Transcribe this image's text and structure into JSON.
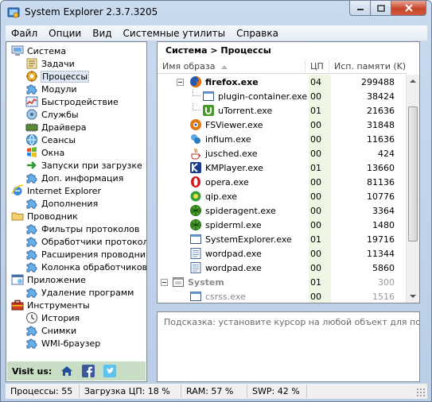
{
  "window": {
    "title": "System Explorer 2.3.7.3205"
  },
  "menu": [
    "Файл",
    "Опции",
    "Вид",
    "Системные утилиты",
    "Справка"
  ],
  "tree": [
    {
      "label": "Система",
      "indent": 0,
      "icon": "computer-icon"
    },
    {
      "label": "Задачи",
      "indent": 1,
      "icon": "tasks-icon"
    },
    {
      "label": "Процессы",
      "indent": 1,
      "icon": "processes-icon",
      "selected": true
    },
    {
      "label": "Модули",
      "indent": 1,
      "icon": "puzzle-icon"
    },
    {
      "label": "Быстродействие",
      "indent": 1,
      "icon": "performance-icon"
    },
    {
      "label": "Службы",
      "indent": 1,
      "icon": "services-icon"
    },
    {
      "label": "Драйвера",
      "indent": 1,
      "icon": "drivers-icon"
    },
    {
      "label": "Сеансы",
      "indent": 1,
      "icon": "sessions-icon"
    },
    {
      "label": "Окна",
      "indent": 1,
      "icon": "windows-icon"
    },
    {
      "label": "Запуски при загрузке",
      "indent": 1,
      "icon": "startup-icon"
    },
    {
      "label": "Доп. информация",
      "indent": 1,
      "icon": "puzzle-icon"
    },
    {
      "label": "Internet Explorer",
      "indent": 0,
      "icon": "ie-icon"
    },
    {
      "label": "Дополнения",
      "indent": 1,
      "icon": "puzzle-icon"
    },
    {
      "label": "Проводник",
      "indent": 0,
      "icon": "folder-icon"
    },
    {
      "label": "Фильтры протоколов",
      "indent": 1,
      "icon": "puzzle-icon"
    },
    {
      "label": "Обработчики протокола",
      "indent": 1,
      "icon": "puzzle-icon"
    },
    {
      "label": "Расширения проводника",
      "indent": 1,
      "icon": "puzzle-icon"
    },
    {
      "label": "Колонка обработчиков",
      "indent": 1,
      "icon": "puzzle-icon"
    },
    {
      "label": "Приложение",
      "indent": 0,
      "icon": "application-icon"
    },
    {
      "label": "Удаление программ",
      "indent": 1,
      "icon": "puzzle-icon"
    },
    {
      "label": "Инструменты",
      "indent": 0,
      "icon": "toolbox-icon"
    },
    {
      "label": "История",
      "indent": 1,
      "icon": "clock-icon"
    },
    {
      "label": "Снимки",
      "indent": 1,
      "icon": "puzzle-icon"
    },
    {
      "label": "WMI-браузер",
      "indent": 1,
      "icon": "puzzle-icon"
    }
  ],
  "visit": {
    "label": "Visit us:",
    "icons": [
      "home-icon",
      "facebook-icon",
      "twitter-icon"
    ]
  },
  "processes": {
    "breadcrumb": "Система > Процессы",
    "columns": {
      "name": "Имя образа",
      "cpu": "ЦП",
      "mem": "Исп. памяти (K)"
    },
    "rows": [
      {
        "name": "firefox.exe",
        "cpu": "04",
        "mem": "299488",
        "level": 1,
        "icon": "firefox-icon",
        "bold": true,
        "expander": "minus"
      },
      {
        "name": "plugin-container.exe",
        "cpu": "00",
        "mem": "38424",
        "level": 2,
        "icon": "window-icon"
      },
      {
        "name": "uTorrent.exe",
        "cpu": "01",
        "mem": "21636",
        "level": 2,
        "icon": "utorrent-icon"
      },
      {
        "name": "FSViewer.exe",
        "cpu": "00",
        "mem": "31848",
        "level": 1,
        "icon": "fsviewer-icon"
      },
      {
        "name": "infium.exe",
        "cpu": "00",
        "mem": "11636",
        "level": 1,
        "icon": "infium-icon"
      },
      {
        "name": "jusched.exe",
        "cpu": "00",
        "mem": "424",
        "level": 1,
        "icon": "java-icon"
      },
      {
        "name": "KMPlayer.exe",
        "cpu": "01",
        "mem": "13660",
        "level": 1,
        "icon": "kmplayer-icon"
      },
      {
        "name": "opera.exe",
        "cpu": "00",
        "mem": "81136",
        "level": 1,
        "icon": "opera-icon"
      },
      {
        "name": "qip.exe",
        "cpu": "00",
        "mem": "10776",
        "level": 1,
        "icon": "qip-icon"
      },
      {
        "name": "spideragent.exe",
        "cpu": "00",
        "mem": "3364",
        "level": 1,
        "icon": "spider-icon"
      },
      {
        "name": "spiderml.exe",
        "cpu": "00",
        "mem": "1480",
        "level": 1,
        "icon": "spider-icon"
      },
      {
        "name": "SystemExplorer.exe",
        "cpu": "01",
        "mem": "19716",
        "level": 1,
        "icon": "window-icon"
      },
      {
        "name": "wordpad.exe",
        "cpu": "00",
        "mem": "11344",
        "level": 1,
        "icon": "wordpad-icon"
      },
      {
        "name": "wordpad.exe",
        "cpu": "00",
        "mem": "5860",
        "level": 1,
        "icon": "wordpad-icon"
      },
      {
        "name": "System",
        "cpu": "01",
        "mem": "300",
        "level": 0,
        "icon": "system-icon",
        "bold": true,
        "grey": true,
        "expander": "minus"
      },
      {
        "name": "csrss.exe",
        "cpu": "00",
        "mem": "1516",
        "level": 1,
        "icon": "window-icon",
        "grey": true
      }
    ]
  },
  "hint": "Подсказка: установите курсор на любой объект для получения",
  "status": [
    "Процессы: 55",
    "Загрузка ЦП: 18 %",
    "RAM: 57 %",
    "SWP: 42 %"
  ]
}
